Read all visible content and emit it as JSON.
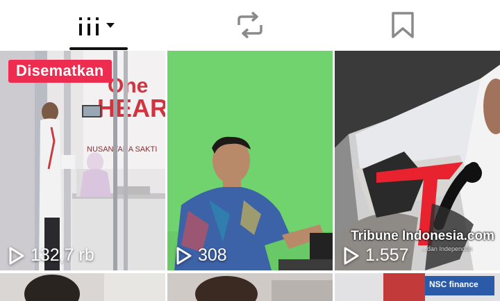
{
  "tabs": [
    {
      "name": "videos",
      "icon": "grid-icon",
      "active": true
    },
    {
      "name": "reposts",
      "icon": "repost-icon",
      "active": false
    },
    {
      "name": "saved",
      "icon": "bookmark-icon",
      "active": false
    }
  ],
  "videos": [
    {
      "views": "132,7 rb",
      "pinned_label": "Disematkan"
    },
    {
      "views": "308"
    },
    {
      "views": "1.557"
    }
  ],
  "watermark": {
    "brand": "Tribune Indonesia.com",
    "sub": "...dan Independen"
  },
  "colors": {
    "pinned_badge": "#ee2c4f",
    "active_underline": "#111111",
    "icon_gray": "#8a8a8a"
  }
}
